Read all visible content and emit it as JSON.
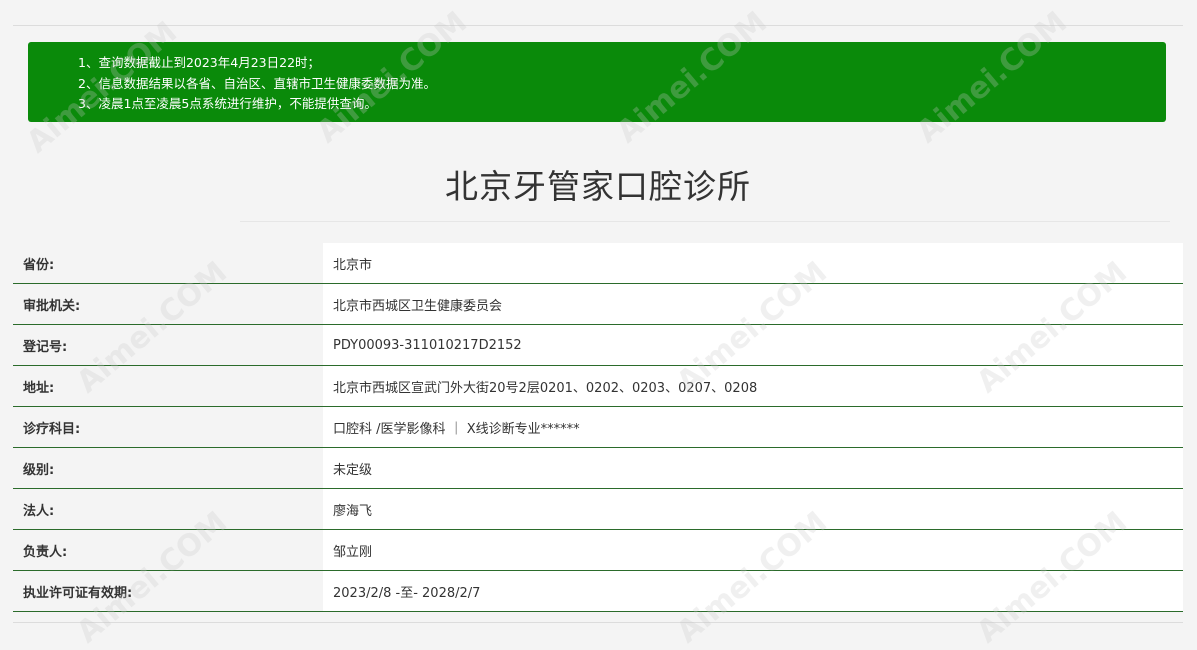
{
  "notice": {
    "lines": [
      "1、查询数据截止到2023年4月23日22时；",
      "2、信息数据结果以各省、自治区、直辖市卫生健康委数据为准。",
      "3、凌晨1点至凌晨5点系统进行维护，不能提供查询。"
    ]
  },
  "title": "北京牙管家口腔诊所",
  "rows": [
    {
      "label": "省份:",
      "value": "北京市"
    },
    {
      "label": "审批机关:",
      "value": "北京市西城区卫生健康委员会"
    },
    {
      "label": "登记号:",
      "value": "PDY00093-311010217D2152"
    },
    {
      "label": "地址:",
      "value": "北京市西城区宣武门外大街20号2层0201、0202、0203、0207、0208"
    },
    {
      "label": "诊疗科目:",
      "value": "口腔科 /医学影像科 ｜ X线诊断专业******"
    },
    {
      "label": "级别:",
      "value": "未定级"
    },
    {
      "label": "法人:",
      "value": "廖海飞"
    },
    {
      "label": "负责人:",
      "value": "邹立刚"
    },
    {
      "label": "执业许可证有效期:",
      "value": "2023/2/8 -至- 2028/2/7"
    }
  ],
  "watermark": "Aimei.COM",
  "colors": {
    "notice_bg": "#0a8a0a",
    "row_border": "#2b6b2b"
  }
}
